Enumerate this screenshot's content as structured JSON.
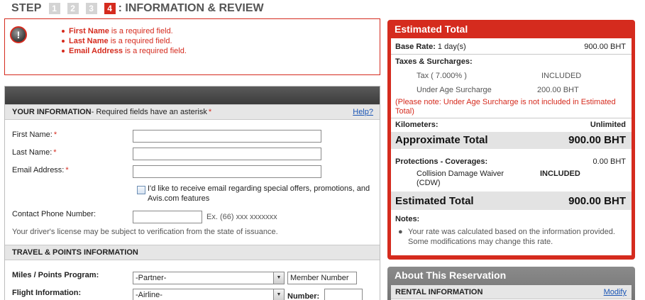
{
  "step": {
    "word": "STEP",
    "numbers": [
      "1",
      "2",
      "3",
      "4"
    ],
    "title": ": INFORMATION & REVIEW"
  },
  "errors": [
    {
      "field": "First Name",
      "message": " is a required field."
    },
    {
      "field": "Last Name",
      "message": " is a required field."
    },
    {
      "field": "Email Address",
      "message": " is a required field."
    }
  ],
  "your_info": {
    "heading": "YOUR INFORMATION",
    "subheading": " - Required fields have an asterisk",
    "asterisk": "*",
    "help": "Help?",
    "first_name_label": "First Name:",
    "last_name_label": "Last Name:",
    "email_label": "Email Address:",
    "offers_text": "I'd like to receive email regarding special offers, promotions, and Avis.com features",
    "phone_label": "Contact Phone Number:",
    "phone_hint": "Ex. (66) xxx xxxxxxx",
    "license_note": "Your driver's license may be subject to verification from the state of issuance."
  },
  "travel": {
    "heading": "TRAVEL & POINTS INFORMATION",
    "miles_label": "Miles / Points Program:",
    "miles_selected": "-Partner-",
    "member_number": "Member Number",
    "flight_label": "Flight Information:",
    "airline_selected": "-Airline-",
    "number_label": "Number:"
  },
  "estimate": {
    "title": "Estimated Total",
    "base_rate_label": "Base Rate:",
    "base_rate_days": " 1 day(s)",
    "base_rate_value": "900.00 BHT",
    "taxes_label": "Taxes & Surcharges:",
    "tax_label": "Tax ( 7.000% )",
    "tax_value": "INCLUDED",
    "underage_label": "Under Age Surcharge",
    "underage_value": "200.00 BHT",
    "underage_note": "(Please note: Under Age Surcharge is not included in Estimated Total)",
    "km_label": "Kilometers:",
    "km_value": "Unlimited",
    "approx_label": "Approximate Total",
    "approx_value": "900.00 BHT",
    "protections_label": "Protections - Coverages:",
    "protections_value": "0.00 BHT",
    "cdw_label": "Collision Damage Waiver (CDW)",
    "cdw_value": "INCLUDED",
    "estimated_label": "Estimated Total",
    "estimated_value": "900.00 BHT",
    "notes_label": "Notes:",
    "note_text": "Your rate was calculated based on the information provided. Some modifications may change this rate."
  },
  "about": {
    "title": "About This Reservation",
    "rental_info": "RENTAL INFORMATION",
    "modify": "Modify"
  },
  "colors": {
    "accent_red": "#d52b1e",
    "link_blue": "#1a55b5",
    "panel_grey": "#e6e6e6"
  }
}
